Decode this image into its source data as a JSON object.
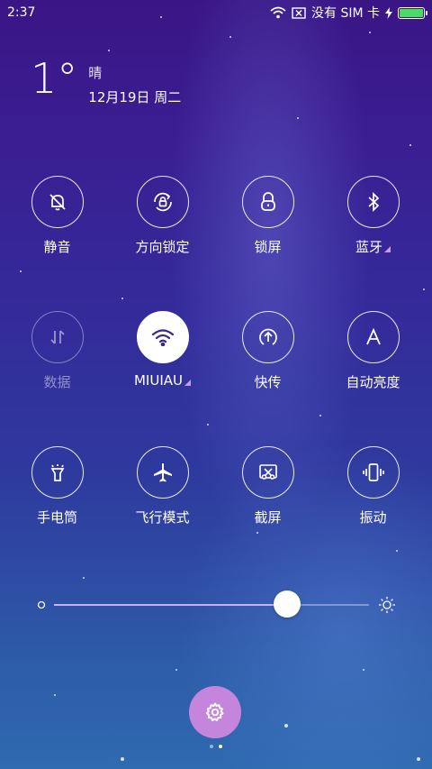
{
  "status_bar": {
    "time": "2:37",
    "carrier": "没有 SIM 卡",
    "battery_level": 1.0
  },
  "weather": {
    "temperature": "1°",
    "condition": "晴",
    "date": "12月19日 周二"
  },
  "toggles": [
    {
      "label": "静音",
      "icon": "silent-bell-icon",
      "state": "off"
    },
    {
      "label": "方向锁定",
      "icon": "rotation-lock-icon",
      "state": "off"
    },
    {
      "label": "锁屏",
      "icon": "lock-icon",
      "state": "off"
    },
    {
      "label": "蓝牙",
      "icon": "bluetooth-icon",
      "state": "off"
    },
    {
      "label": "数据",
      "icon": "mobile-data-icon",
      "state": "disabled"
    },
    {
      "label": "MIUIAU",
      "icon": "wifi-icon",
      "state": "on"
    },
    {
      "label": "快传",
      "icon": "quick-transfer-icon",
      "state": "off"
    },
    {
      "label": "自动亮度",
      "icon": "auto-brightness-icon",
      "state": "off"
    },
    {
      "label": "手电筒",
      "icon": "flashlight-icon",
      "state": "off"
    },
    {
      "label": "飞行模式",
      "icon": "airplane-icon",
      "state": "off"
    },
    {
      "label": "截屏",
      "icon": "screenshot-icon",
      "state": "off"
    },
    {
      "label": "振动",
      "icon": "vibrate-icon",
      "state": "off"
    }
  ],
  "brightness": {
    "level": 0.74
  },
  "settings": {
    "icon": "gear-icon",
    "accent": "#c585dc"
  },
  "pager": {
    "pages": 2,
    "current": 2
  }
}
